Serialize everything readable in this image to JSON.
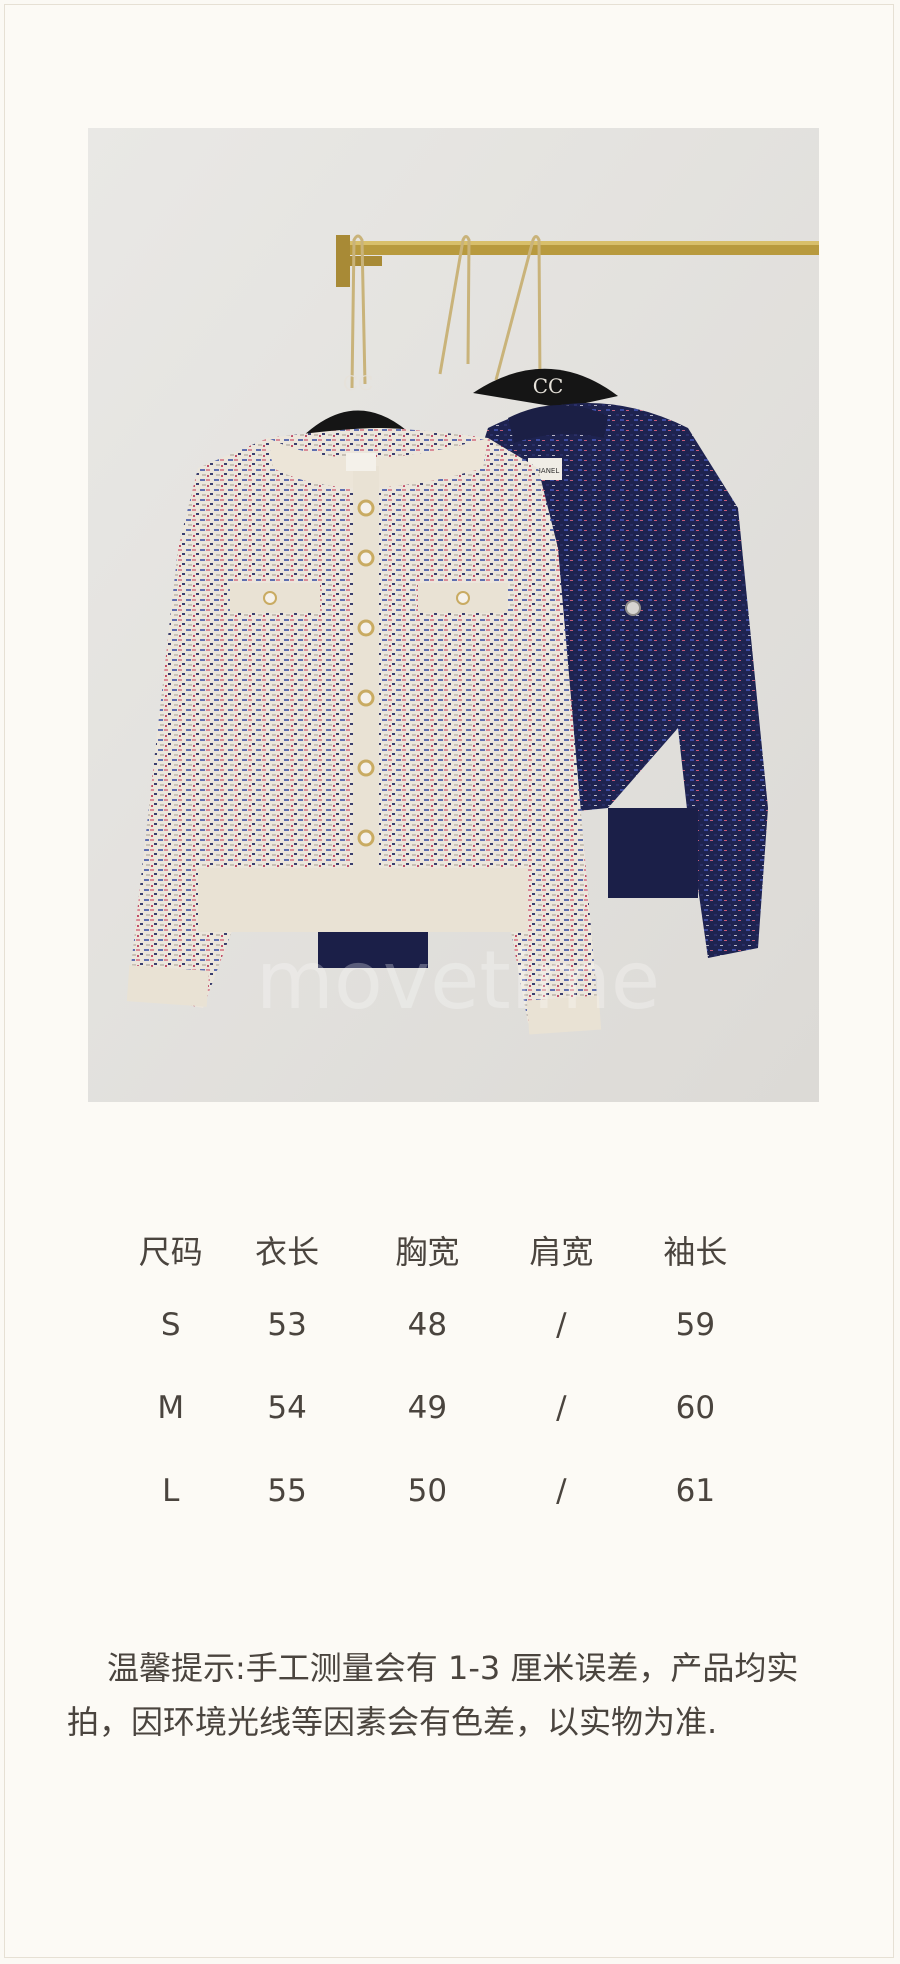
{
  "photo": {
    "watermark": "movetime",
    "hanger_logo": "CC",
    "label_text": "CHANEL"
  },
  "size_chart": {
    "headers": [
      "尺码",
      "衣长",
      "胸宽",
      "肩宽",
      "袖长"
    ],
    "rows": [
      [
        "S",
        "53",
        "48",
        "/",
        "59"
      ],
      [
        "M",
        "54",
        "49",
        "/",
        "60"
      ],
      [
        "L",
        "55",
        "50",
        "/",
        "61"
      ]
    ]
  },
  "notice": "温馨提示:手工测量会有 1-3 厘米误差，产品均实拍，因环境光线等因素会有色差，以实物为准."
}
